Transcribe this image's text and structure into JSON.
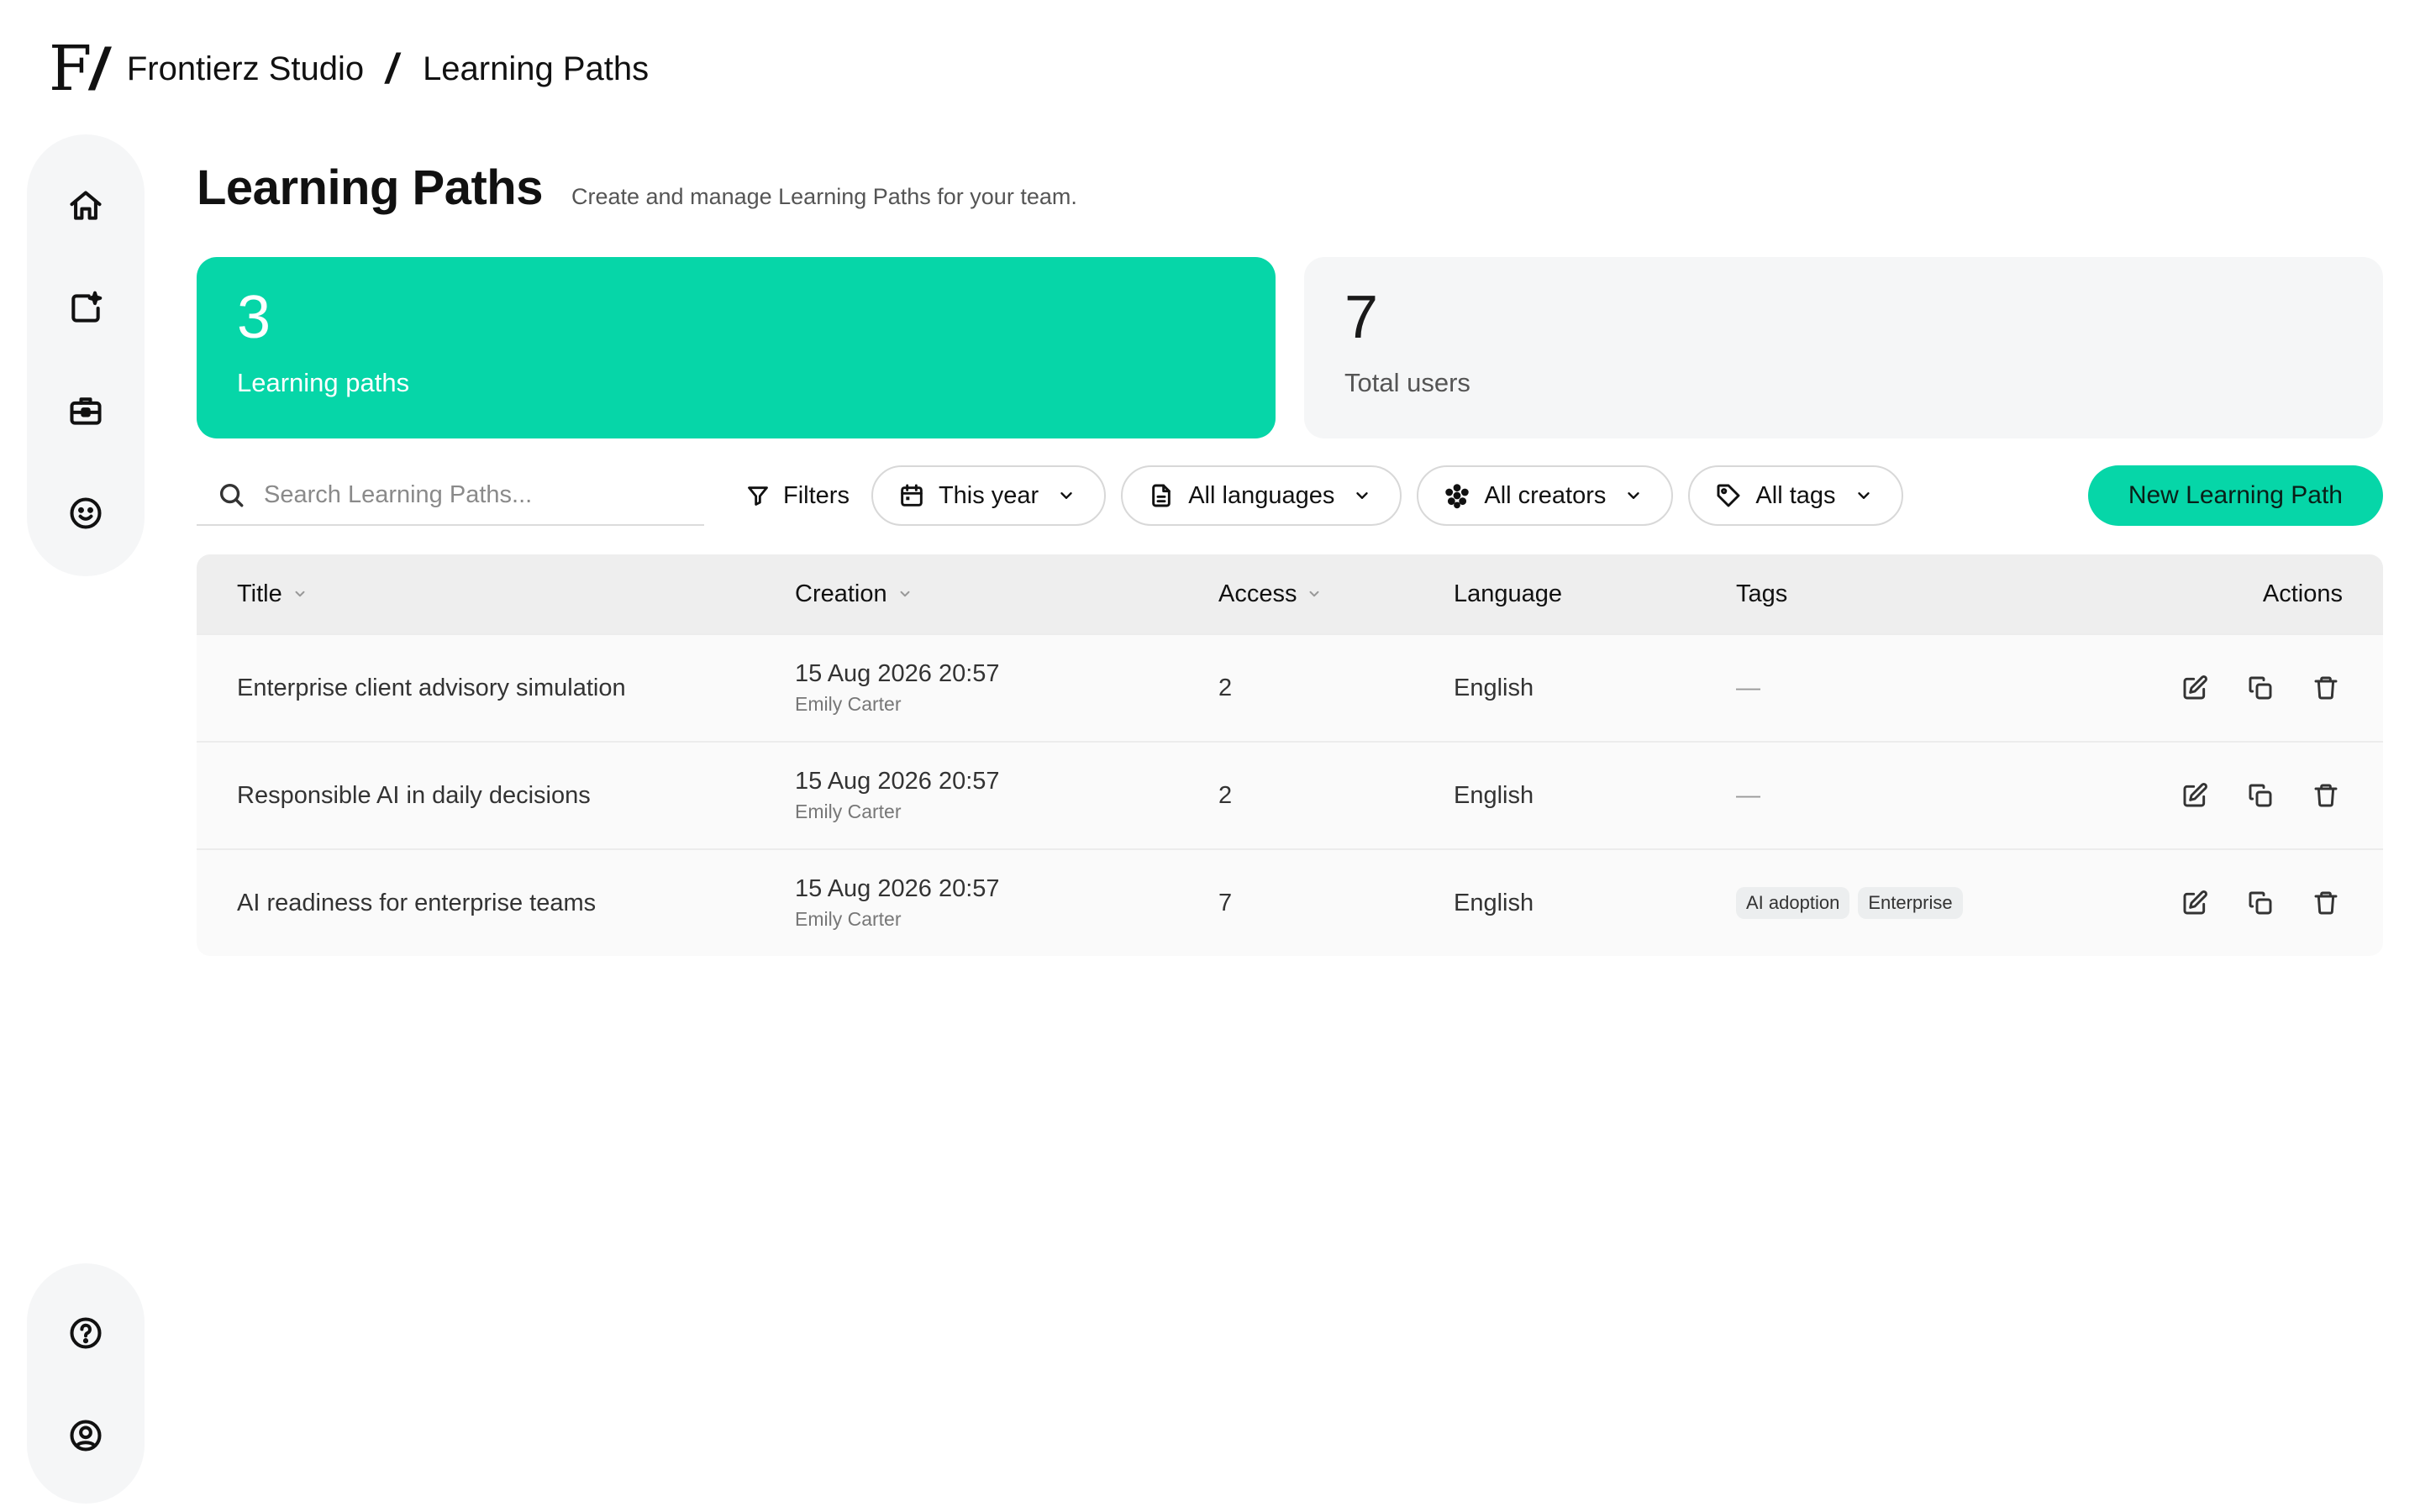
{
  "header": {
    "logo_mark": "F",
    "logo_slash": "/",
    "workspace": "Frontierz Studio",
    "separator": "/",
    "current_page": "Learning Paths"
  },
  "sidebar": {
    "top_items": [
      {
        "name": "home-icon"
      },
      {
        "name": "create-icon"
      },
      {
        "name": "briefcase-icon"
      },
      {
        "name": "smile-icon"
      }
    ],
    "bottom_items": [
      {
        "name": "help-icon"
      },
      {
        "name": "user-icon"
      }
    ]
  },
  "page": {
    "title": "Learning Paths",
    "subtitle": "Create and manage Learning Paths for your team."
  },
  "stats": {
    "learning_paths": {
      "value": "3",
      "label": "Learning paths"
    },
    "total_users": {
      "value": "7",
      "label": "Total users"
    }
  },
  "toolbar": {
    "search_placeholder": "Search Learning Paths...",
    "filters_label": "Filters",
    "date_filter": "This year",
    "language_filter": "All languages",
    "creator_filter": "All creators",
    "tag_filter": "All tags",
    "new_button": "New Learning Path"
  },
  "table": {
    "columns": {
      "title": "Title",
      "creation": "Creation",
      "access": "Access",
      "language": "Language",
      "tags": "Tags",
      "actions": "Actions"
    },
    "rows": [
      {
        "title": "Enterprise client advisory simulation",
        "date": "15 Aug 2026 20:57",
        "creator": "Emily Carter",
        "access": "2",
        "language": "English",
        "tags_empty": "—"
      },
      {
        "title": "Responsible AI in daily decisions",
        "date": "15 Aug 2026 20:57",
        "creator": "Emily Carter",
        "access": "2",
        "language": "English",
        "tags_empty": "—"
      },
      {
        "title": "AI readiness for enterprise teams",
        "date": "15 Aug 2026 20:57",
        "creator": "Emily Carter",
        "access": "7",
        "language": "English",
        "tags": [
          "AI adoption",
          "Enterprise"
        ]
      }
    ]
  },
  "colors": {
    "accent": "#06d6a8",
    "surface": "#f5f6f7",
    "table_header": "#eeeeee"
  }
}
